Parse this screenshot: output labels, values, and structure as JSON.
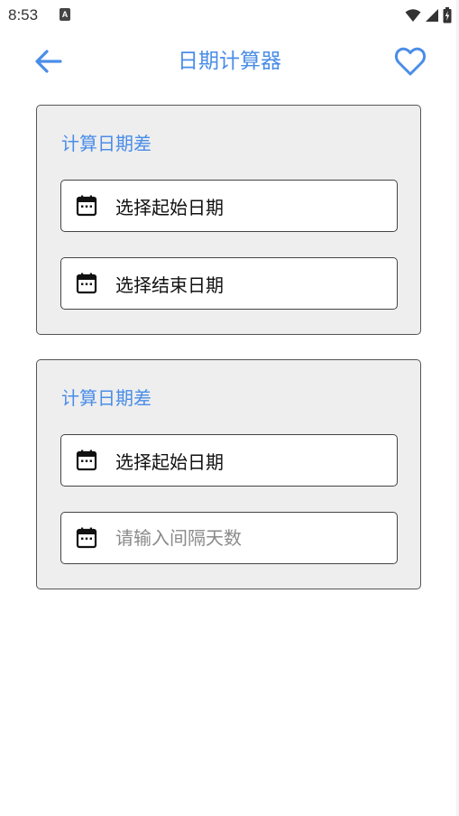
{
  "status_bar": {
    "time": "8:53",
    "notification_icon_letter": "A",
    "icons": [
      "wifi-icon",
      "signal-icon",
      "battery-icon"
    ]
  },
  "app_bar": {
    "title": "日期计算器",
    "back_icon": "arrow-left-icon",
    "favorite_icon": "heart-outline-icon",
    "accent_color": "#4a8de8"
  },
  "cards": [
    {
      "title": "计算日期差",
      "start_date_label": "选择起始日期",
      "end_date_label": "选择结束日期"
    },
    {
      "title": "计算日期差",
      "start_date_label": "选择起始日期",
      "interval_days_placeholder": "请输入间隔天数",
      "interval_days_value": ""
    }
  ]
}
